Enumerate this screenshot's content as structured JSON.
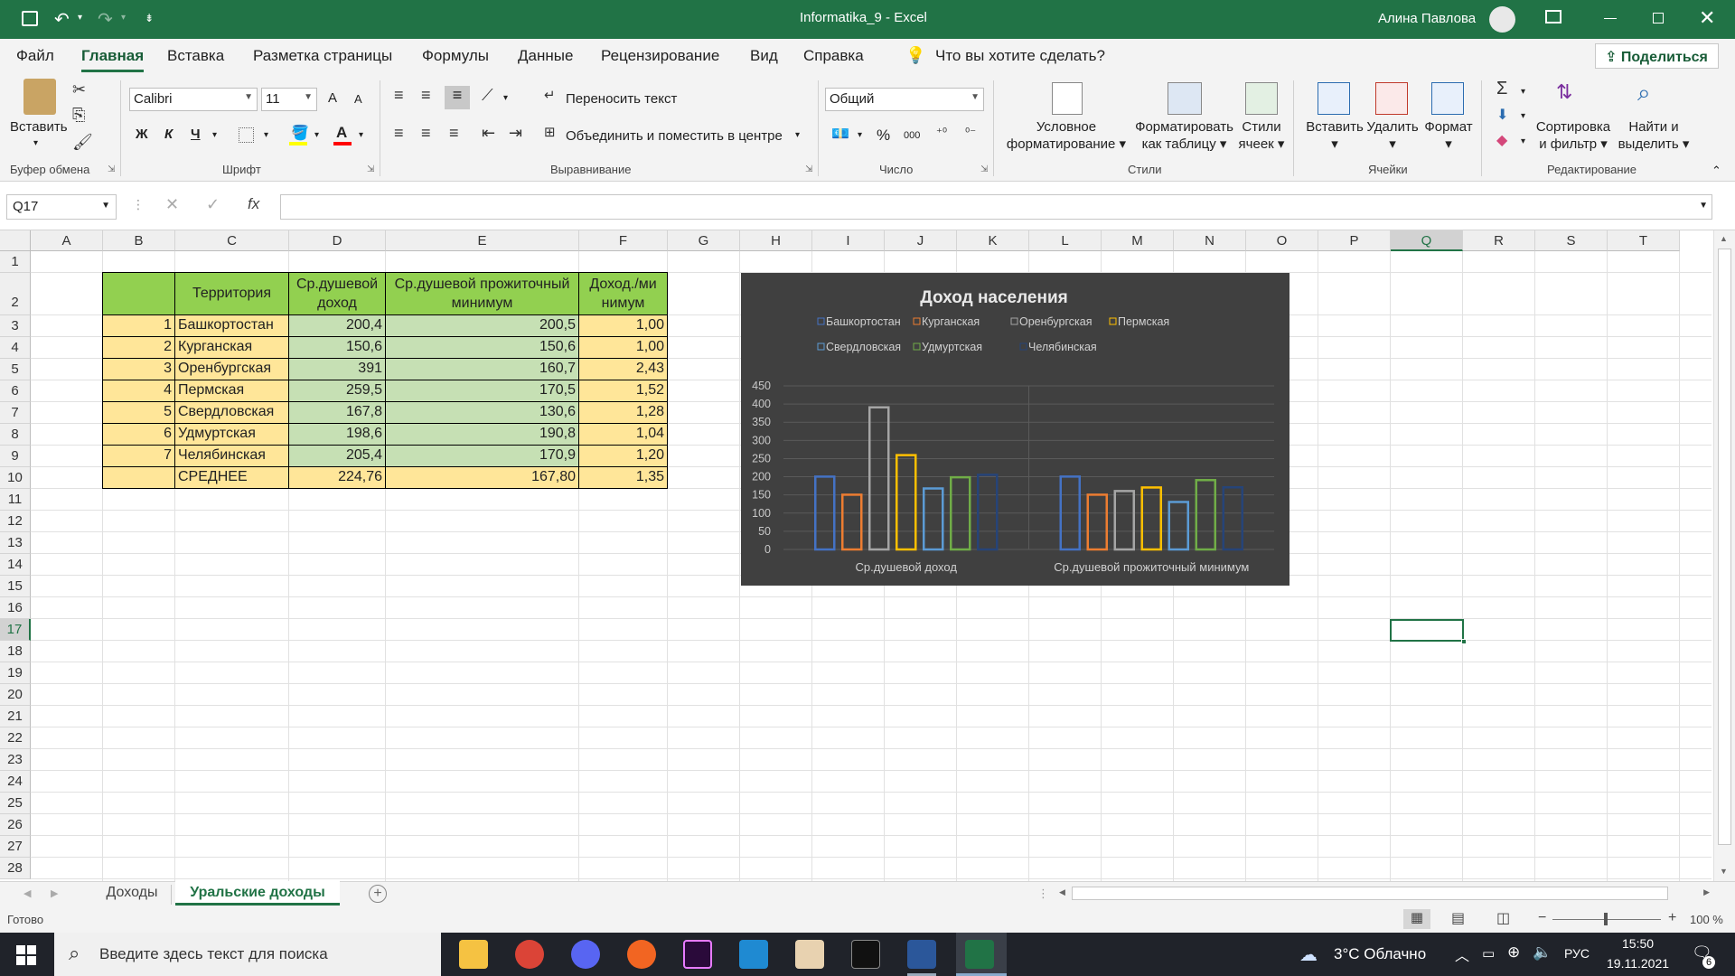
{
  "window": {
    "title": "Informatika_9  -  Excel",
    "user": "Алина Павлова"
  },
  "tabs": [
    "Файл",
    "Главная",
    "Вставка",
    "Разметка страницы",
    "Формулы",
    "Данные",
    "Рецензирование",
    "Вид",
    "Справка"
  ],
  "tell_me": "Что вы хотите сделать?",
  "share": "Поделиться",
  "ribbon": {
    "paste": "Вставить",
    "font_name": "Calibri",
    "font_size": "11",
    "bold": "Ж",
    "italic": "К",
    "underline": "Ч",
    "grow": "A",
    "shrink": "A",
    "wrap_text": "Переносить текст",
    "merge_center": "Объединить и поместить в центре",
    "number_format": "Общий",
    "percent": "%",
    "thousands": "000",
    "cond_format_1": "Условное",
    "cond_format_2": "форматирование",
    "format_table_1": "Форматировать",
    "format_table_2": "как таблицу",
    "cell_styles_1": "Стили",
    "cell_styles_2": "ячеек",
    "insert": "Вставить",
    "delete": "Удалить",
    "format": "Формат",
    "sort_1": "Сортировка",
    "sort_2": "и фильтр",
    "find_1": "Найти и",
    "find_2": "выделить",
    "groups": {
      "clipboard": "Буфер обмена",
      "font": "Шрифт",
      "alignment": "Выравнивание",
      "number": "Число",
      "styles": "Стили",
      "cells": "Ячейки",
      "editing": "Редактирование"
    }
  },
  "formula_bar": {
    "name_box": "Q17",
    "fx": "fx",
    "value": ""
  },
  "columns": [
    "A",
    "B",
    "C",
    "D",
    "E",
    "F",
    "G",
    "H",
    "I",
    "J",
    "K",
    "L",
    "M",
    "N",
    "O",
    "P",
    "Q",
    "R",
    "S",
    "T"
  ],
  "rows": [
    "1",
    "2",
    "3",
    "4",
    "5",
    "6",
    "7",
    "8",
    "9",
    "10",
    "11",
    "12",
    "13",
    "14",
    "15",
    "16",
    "17",
    "18",
    "19",
    "20",
    "21",
    "22",
    "23",
    "24",
    "25",
    "26",
    "27",
    "28"
  ],
  "table": {
    "headers": [
      "",
      "Территория",
      "Ср.душевой доход",
      "Ср.душевой прожиточный минимум",
      "Доход./минимум"
    ],
    "header_lines": {
      "d": [
        "Ср.душевой",
        "доход"
      ],
      "e": [
        "Ср.душевой прожиточный",
        "минимум"
      ],
      "f": [
        "Доход./ми",
        "нимум"
      ]
    },
    "rows": [
      [
        "1",
        "Башкортостан",
        "200,4",
        "200,5",
        "1,00"
      ],
      [
        "2",
        "Курганская",
        "150,6",
        "150,6",
        "1,00"
      ],
      [
        "3",
        "Оренбургская",
        "391",
        "160,7",
        "2,43"
      ],
      [
        "4",
        "Пермская",
        "259,5",
        "170,5",
        "1,52"
      ],
      [
        "5",
        "Свердловская",
        "167,8",
        "130,6",
        "1,28"
      ],
      [
        "6",
        "Удмуртская",
        "198,6",
        "190,8",
        "1,04"
      ],
      [
        "7",
        "Челябинская",
        "205,4",
        "170,9",
        "1,20"
      ]
    ],
    "avg": [
      "",
      "СРЕДНЕЕ",
      "224,76",
      "167,80",
      "1,35"
    ]
  },
  "chart_data": {
    "type": "bar",
    "title": "Доход населения",
    "categories": [
      "Ср.душевой доход",
      "Ср.душевой прожиточный минимум"
    ],
    "series": [
      {
        "name": "Башкортостан",
        "values": [
          200.4,
          200.5
        ],
        "color": "#4472c4"
      },
      {
        "name": "Курганская",
        "values": [
          150.6,
          150.6
        ],
        "color": "#ed7d31"
      },
      {
        "name": "Оренбургская",
        "values": [
          391,
          160.7
        ],
        "color": "#a5a5a5"
      },
      {
        "name": "Пермская",
        "values": [
          259.5,
          170.5
        ],
        "color": "#ffc000"
      },
      {
        "name": "Свердловская",
        "values": [
          167.8,
          130.6
        ],
        "color": "#5b9bd5"
      },
      {
        "name": "Удмуртская",
        "values": [
          198.6,
          190.8
        ],
        "color": "#70ad47"
      },
      {
        "name": "Челябинская",
        "values": [
          205.4,
          170.9
        ],
        "color": "#264478"
      }
    ],
    "yticks": [
      "0",
      "50",
      "100",
      "150",
      "200",
      "250",
      "300",
      "350",
      "400",
      "450"
    ],
    "ylim": [
      0,
      450
    ],
    "legend": "top",
    "grid": true
  },
  "sheets": [
    "Доходы",
    "Уральские доходы"
  ],
  "active_sheet": "Уральские доходы",
  "status": {
    "ready": "Готово",
    "zoom": "100 %"
  },
  "taskbar": {
    "search": "Введите здесь текст для поиска",
    "weather": "3°C  Облачно",
    "lang": "РУС",
    "time": "15:50",
    "date": "19.11.2021",
    "notif": "6"
  }
}
